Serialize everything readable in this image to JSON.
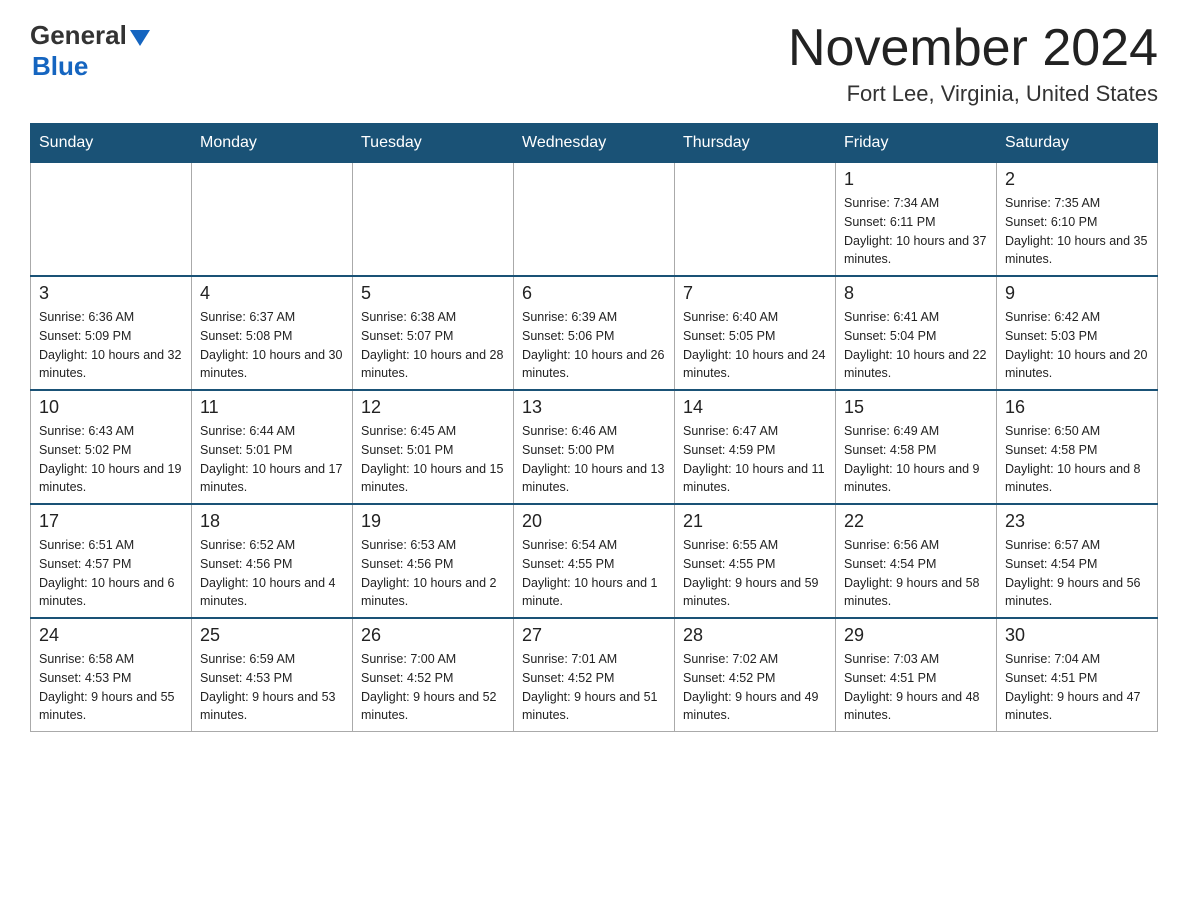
{
  "header": {
    "logo_general": "General",
    "logo_blue": "Blue",
    "month_title": "November 2024",
    "location": "Fort Lee, Virginia, United States"
  },
  "days_of_week": [
    "Sunday",
    "Monday",
    "Tuesday",
    "Wednesday",
    "Thursday",
    "Friday",
    "Saturday"
  ],
  "weeks": [
    [
      {
        "day": "",
        "sunrise": "",
        "sunset": "",
        "daylight": ""
      },
      {
        "day": "",
        "sunrise": "",
        "sunset": "",
        "daylight": ""
      },
      {
        "day": "",
        "sunrise": "",
        "sunset": "",
        "daylight": ""
      },
      {
        "day": "",
        "sunrise": "",
        "sunset": "",
        "daylight": ""
      },
      {
        "day": "",
        "sunrise": "",
        "sunset": "",
        "daylight": ""
      },
      {
        "day": "1",
        "sunrise": "Sunrise: 7:34 AM",
        "sunset": "Sunset: 6:11 PM",
        "daylight": "Daylight: 10 hours and 37 minutes."
      },
      {
        "day": "2",
        "sunrise": "Sunrise: 7:35 AM",
        "sunset": "Sunset: 6:10 PM",
        "daylight": "Daylight: 10 hours and 35 minutes."
      }
    ],
    [
      {
        "day": "3",
        "sunrise": "Sunrise: 6:36 AM",
        "sunset": "Sunset: 5:09 PM",
        "daylight": "Daylight: 10 hours and 32 minutes."
      },
      {
        "day": "4",
        "sunrise": "Sunrise: 6:37 AM",
        "sunset": "Sunset: 5:08 PM",
        "daylight": "Daylight: 10 hours and 30 minutes."
      },
      {
        "day": "5",
        "sunrise": "Sunrise: 6:38 AM",
        "sunset": "Sunset: 5:07 PM",
        "daylight": "Daylight: 10 hours and 28 minutes."
      },
      {
        "day": "6",
        "sunrise": "Sunrise: 6:39 AM",
        "sunset": "Sunset: 5:06 PM",
        "daylight": "Daylight: 10 hours and 26 minutes."
      },
      {
        "day": "7",
        "sunrise": "Sunrise: 6:40 AM",
        "sunset": "Sunset: 5:05 PM",
        "daylight": "Daylight: 10 hours and 24 minutes."
      },
      {
        "day": "8",
        "sunrise": "Sunrise: 6:41 AM",
        "sunset": "Sunset: 5:04 PM",
        "daylight": "Daylight: 10 hours and 22 minutes."
      },
      {
        "day": "9",
        "sunrise": "Sunrise: 6:42 AM",
        "sunset": "Sunset: 5:03 PM",
        "daylight": "Daylight: 10 hours and 20 minutes."
      }
    ],
    [
      {
        "day": "10",
        "sunrise": "Sunrise: 6:43 AM",
        "sunset": "Sunset: 5:02 PM",
        "daylight": "Daylight: 10 hours and 19 minutes."
      },
      {
        "day": "11",
        "sunrise": "Sunrise: 6:44 AM",
        "sunset": "Sunset: 5:01 PM",
        "daylight": "Daylight: 10 hours and 17 minutes."
      },
      {
        "day": "12",
        "sunrise": "Sunrise: 6:45 AM",
        "sunset": "Sunset: 5:01 PM",
        "daylight": "Daylight: 10 hours and 15 minutes."
      },
      {
        "day": "13",
        "sunrise": "Sunrise: 6:46 AM",
        "sunset": "Sunset: 5:00 PM",
        "daylight": "Daylight: 10 hours and 13 minutes."
      },
      {
        "day": "14",
        "sunrise": "Sunrise: 6:47 AM",
        "sunset": "Sunset: 4:59 PM",
        "daylight": "Daylight: 10 hours and 11 minutes."
      },
      {
        "day": "15",
        "sunrise": "Sunrise: 6:49 AM",
        "sunset": "Sunset: 4:58 PM",
        "daylight": "Daylight: 10 hours and 9 minutes."
      },
      {
        "day": "16",
        "sunrise": "Sunrise: 6:50 AM",
        "sunset": "Sunset: 4:58 PM",
        "daylight": "Daylight: 10 hours and 8 minutes."
      }
    ],
    [
      {
        "day": "17",
        "sunrise": "Sunrise: 6:51 AM",
        "sunset": "Sunset: 4:57 PM",
        "daylight": "Daylight: 10 hours and 6 minutes."
      },
      {
        "day": "18",
        "sunrise": "Sunrise: 6:52 AM",
        "sunset": "Sunset: 4:56 PM",
        "daylight": "Daylight: 10 hours and 4 minutes."
      },
      {
        "day": "19",
        "sunrise": "Sunrise: 6:53 AM",
        "sunset": "Sunset: 4:56 PM",
        "daylight": "Daylight: 10 hours and 2 minutes."
      },
      {
        "day": "20",
        "sunrise": "Sunrise: 6:54 AM",
        "sunset": "Sunset: 4:55 PM",
        "daylight": "Daylight: 10 hours and 1 minute."
      },
      {
        "day": "21",
        "sunrise": "Sunrise: 6:55 AM",
        "sunset": "Sunset: 4:55 PM",
        "daylight": "Daylight: 9 hours and 59 minutes."
      },
      {
        "day": "22",
        "sunrise": "Sunrise: 6:56 AM",
        "sunset": "Sunset: 4:54 PM",
        "daylight": "Daylight: 9 hours and 58 minutes."
      },
      {
        "day": "23",
        "sunrise": "Sunrise: 6:57 AM",
        "sunset": "Sunset: 4:54 PM",
        "daylight": "Daylight: 9 hours and 56 minutes."
      }
    ],
    [
      {
        "day": "24",
        "sunrise": "Sunrise: 6:58 AM",
        "sunset": "Sunset: 4:53 PM",
        "daylight": "Daylight: 9 hours and 55 minutes."
      },
      {
        "day": "25",
        "sunrise": "Sunrise: 6:59 AM",
        "sunset": "Sunset: 4:53 PM",
        "daylight": "Daylight: 9 hours and 53 minutes."
      },
      {
        "day": "26",
        "sunrise": "Sunrise: 7:00 AM",
        "sunset": "Sunset: 4:52 PM",
        "daylight": "Daylight: 9 hours and 52 minutes."
      },
      {
        "day": "27",
        "sunrise": "Sunrise: 7:01 AM",
        "sunset": "Sunset: 4:52 PM",
        "daylight": "Daylight: 9 hours and 51 minutes."
      },
      {
        "day": "28",
        "sunrise": "Sunrise: 7:02 AM",
        "sunset": "Sunset: 4:52 PM",
        "daylight": "Daylight: 9 hours and 49 minutes."
      },
      {
        "day": "29",
        "sunrise": "Sunrise: 7:03 AM",
        "sunset": "Sunset: 4:51 PM",
        "daylight": "Daylight: 9 hours and 48 minutes."
      },
      {
        "day": "30",
        "sunrise": "Sunrise: 7:04 AM",
        "sunset": "Sunset: 4:51 PM",
        "daylight": "Daylight: 9 hours and 47 minutes."
      }
    ]
  ]
}
